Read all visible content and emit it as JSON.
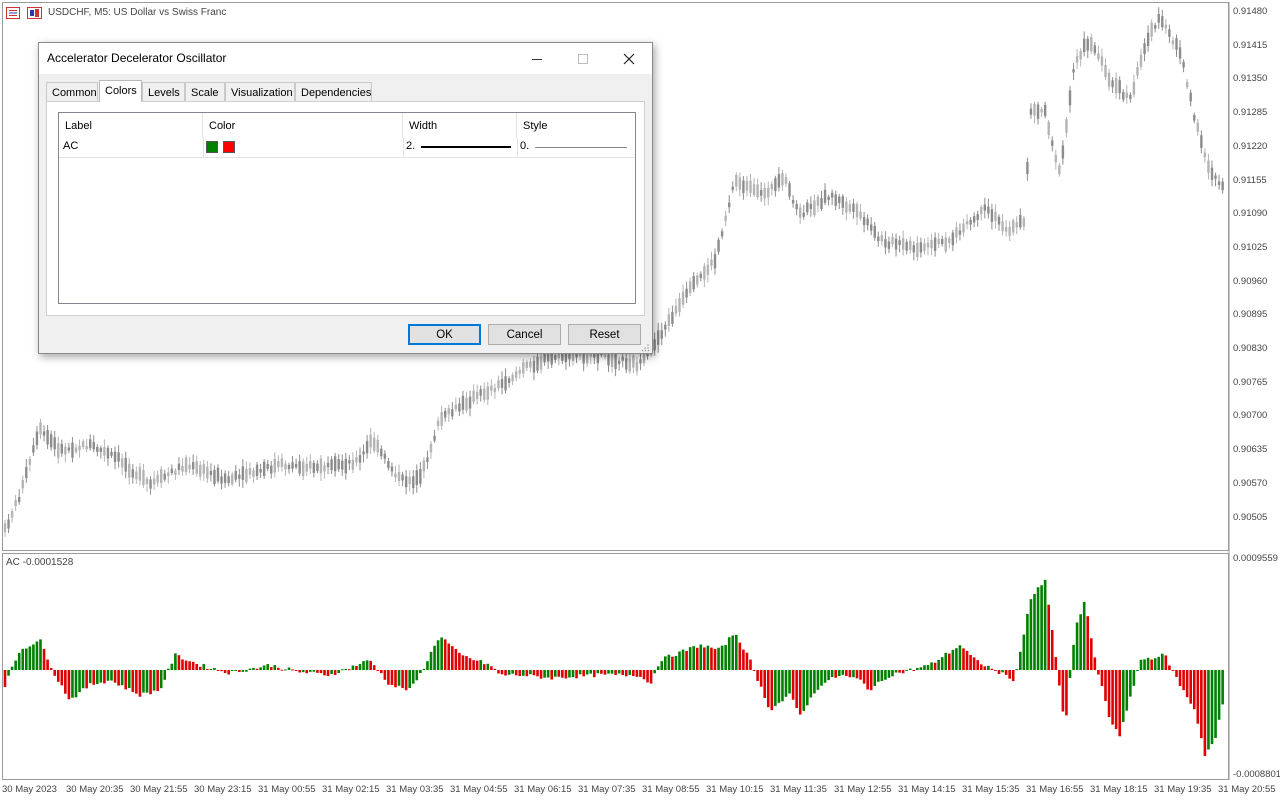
{
  "chart": {
    "symbol_label": "USDCHF, M5:  US Dollar vs Swiss Franc",
    "price_ticks": [
      "0.91480",
      "0.91415",
      "0.91350",
      "0.91285",
      "0.91220",
      "0.91155",
      "0.91090",
      "0.91025",
      "0.90960",
      "0.90895",
      "0.90830",
      "0.90765",
      "0.90700",
      "0.90635",
      "0.90570",
      "0.90505"
    ],
    "time_ticks": [
      "30 May 2023",
      "30 May 20:35",
      "30 May 21:55",
      "30 May 23:15",
      "31 May 00:55",
      "31 May 02:15",
      "31 May 03:35",
      "31 May 04:55",
      "31 May 06:15",
      "31 May 07:35",
      "31 May 08:55",
      "31 May 10:15",
      "31 May 11:35",
      "31 May 12:55",
      "31 May 14:15",
      "31 May 15:35",
      "31 May 16:55",
      "31 May 18:15",
      "31 May 19:35",
      "31 May 20:55"
    ],
    "indicator_label": "AC -0.0001528",
    "indicator_top_value": "0.0009559",
    "indicator_bottom_value": "-0.0008801",
    "colors": {
      "candle": "#8c8c8c",
      "candle_light": "#b4b4b4",
      "ac_up": "#008000",
      "ac_down": "#e00000",
      "border": "#9a9a9a"
    }
  },
  "dialog": {
    "title": "Accelerator Decelerator Oscillator",
    "tabs": [
      "Common",
      "Colors",
      "Levels",
      "Scale",
      "Visualization",
      "Dependencies"
    ],
    "active_tab": "Colors",
    "columns": [
      "Label",
      "Color",
      "Width",
      "Style"
    ],
    "row": {
      "label": "AC",
      "color_up": "#008000",
      "color_down": "#ff0000",
      "width": "2.",
      "style": "0."
    },
    "buttons": {
      "ok": "OK",
      "cancel": "Cancel",
      "reset": "Reset"
    }
  }
}
